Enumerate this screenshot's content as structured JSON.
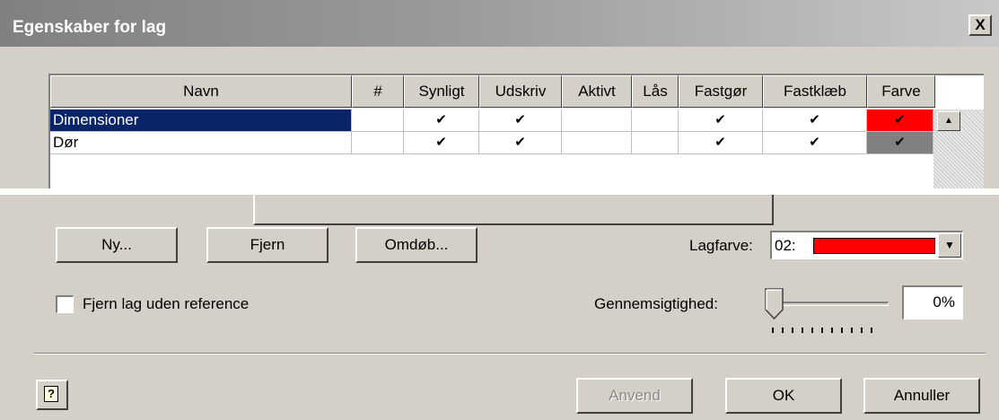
{
  "window": {
    "title": "Egenskaber for lag",
    "close_glyph": "X"
  },
  "grid": {
    "columns": [
      "Navn",
      "#",
      "Synligt",
      "Udskriv",
      "Aktivt",
      "Lås",
      "Fastgør",
      "Fastklæb",
      "Farve"
    ],
    "rows": [
      {
        "name": "Dimensioner",
        "num": "",
        "synligt": "✔",
        "udskriv": "✔",
        "aktivt": "",
        "laas": "",
        "fastgor": "✔",
        "fastklaeb": "✔",
        "farve": "✔",
        "farve_color": "#ff0000",
        "selected": true
      },
      {
        "name": "Dør",
        "num": "",
        "synligt": "✔",
        "udskriv": "✔",
        "aktivt": "",
        "laas": "",
        "fastgor": "✔",
        "fastklaeb": "✔",
        "farve": "✔",
        "farve_color": "#808080",
        "selected": false
      }
    ]
  },
  "buttons": {
    "new": "Ny...",
    "remove": "Fjern",
    "rename": "Omdøb...",
    "apply": "Anvend",
    "ok": "OK",
    "cancel": "Annuller"
  },
  "layer_color": {
    "label": "Lagfarve:",
    "value": "02:",
    "color": "#ff0000"
  },
  "remove_unreferenced": {
    "label": "Fjern lag uden reference",
    "checked": false
  },
  "transparency": {
    "label": "Gennemsigtighed:",
    "value": "0%",
    "level": 0
  },
  "colors": {
    "dialog_bg": "#d4d0c8",
    "selection": "#0a246a"
  }
}
